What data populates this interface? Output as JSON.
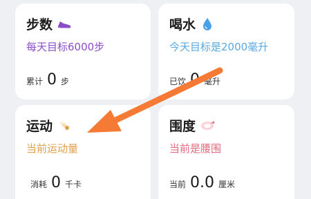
{
  "cards": {
    "steps": {
      "title": "步数",
      "icon": "sneaker-icon",
      "goal": "每天目标6000步",
      "goal_color": "#8a4cc7",
      "stat_label": "累计",
      "stat_value": "0",
      "stat_unit": "步"
    },
    "water": {
      "title": "喝水",
      "icon": "water-drop-icon",
      "goal": "今天目标是2000毫升",
      "goal_color": "#5aa8e0",
      "stat_label": "已饮",
      "stat_value": "0",
      "stat_unit": "毫升"
    },
    "sport": {
      "title": "运动",
      "icon": "shuttlecock-icon",
      "goal": "当前运动量",
      "goal_color": "#e2a04c",
      "stat_label": "消耗",
      "stat_value": "0",
      "stat_unit": "千卡"
    },
    "waist": {
      "title": "围度",
      "icon": "tape-measure-icon",
      "goal": "当前是腰围",
      "goal_color": "#e66a7e",
      "stat_label": "当前",
      "stat_value": "0.0",
      "stat_unit": "厘米"
    }
  },
  "annotation": {
    "arrow_color": "#f47a35"
  }
}
